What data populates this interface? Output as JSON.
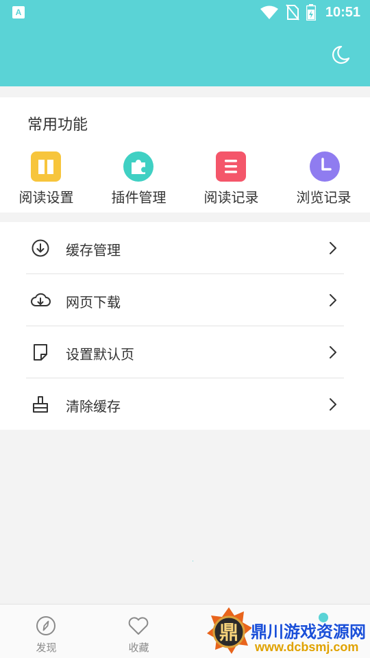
{
  "status_bar": {
    "app_icon_letter": "A",
    "time": "10:51"
  },
  "common": {
    "title": "常用功能",
    "items": [
      {
        "label": "阅读设置",
        "icon": "open-book-icon",
        "color": "#f7c53c"
      },
      {
        "label": "插件管理",
        "icon": "puzzle-icon",
        "color": "#3fd0c3"
      },
      {
        "label": "阅读记录",
        "icon": "list-icon",
        "color": "#f4566a"
      },
      {
        "label": "浏览记录",
        "icon": "clock-icon",
        "color": "#8f7cf0"
      }
    ]
  },
  "menu": {
    "items": [
      {
        "label": "缓存管理",
        "icon": "download-circle-icon"
      },
      {
        "label": "网页下载",
        "icon": "cloud-download-icon"
      },
      {
        "label": "设置默认页",
        "icon": "note-icon"
      },
      {
        "label": "清除缓存",
        "icon": "brush-icon"
      }
    ]
  },
  "bottom_nav": {
    "items": [
      {
        "label": "发现",
        "icon": "compass-icon"
      },
      {
        "label": "收藏",
        "icon": "heart-icon"
      }
    ]
  },
  "watermark": {
    "emblem_char": "鼎",
    "title": "鼎川游戏资源网",
    "url": "www.dcbsmj.com"
  },
  "colors": {
    "accent": "#5ad3d6",
    "background": "#f3f3f3"
  }
}
